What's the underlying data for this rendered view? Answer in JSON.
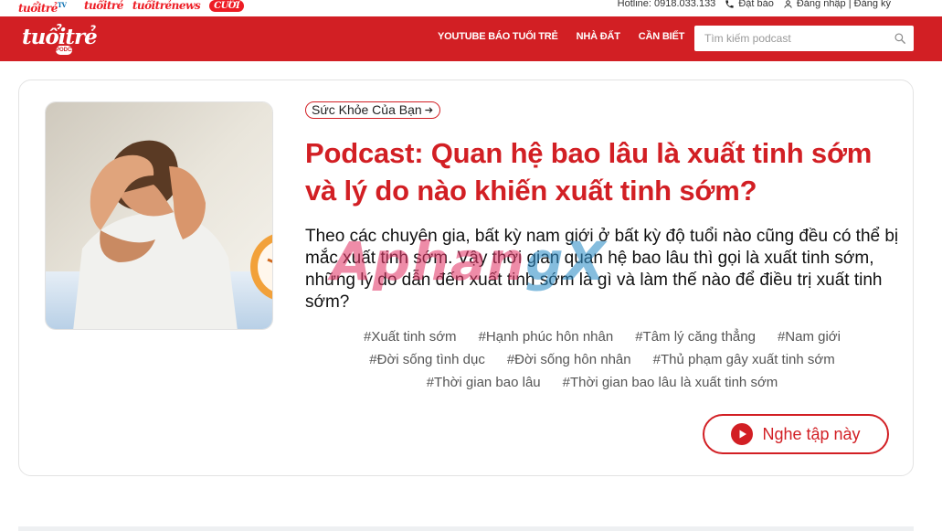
{
  "brands": [
    {
      "name": "tuoi-tre-tv-logo",
      "label": "tuổitrẻ",
      "suffix": "TV"
    },
    {
      "name": "tuoi-tre-cuoi-tuan-logo",
      "label": "tuổitrẻ"
    },
    {
      "name": "tuoi-tre-news-logo",
      "label": "tuổitrẻnews"
    },
    {
      "name": "tuoi-tre-cuoi-logo",
      "label": "CƯỜI"
    }
  ],
  "utility": {
    "hotline": "Hotline: 0918.033.133",
    "subscribe": "Đặt báo",
    "account": "Đăng nhập | Đăng ký"
  },
  "header": {
    "logo_text": "tuổitrẻ",
    "logo_badge": "PODCAST",
    "nav": [
      "YOUTUBE BÁO TUỔI TRẺ",
      "NHÀ ĐẤT",
      "CẦN BIẾT"
    ],
    "search_placeholder": "Tìm kiếm podcast"
  },
  "episode": {
    "category": "Sức Khỏe Của Bạn",
    "title": "Podcast: Quan hệ bao lâu là xuất tinh sớm và lý do nào khiến xuất tinh sớm?",
    "summary": "Theo các chuyên gia, bất kỳ nam giới ở bất kỳ độ tuổi nào cũng đều có thể bị mắc xuất tinh sớm. Vậy thời gian quan hệ bao lâu thì gọi là xuất tinh sớm, những lý do dẫn đến xuất tinh sớm là gì và làm thế nào để điều trị xuất tinh sớm?",
    "tags": [
      "#Xuất tinh sớm",
      "#Hạnh phúc hôn nhân",
      "#Tâm lý căng thẳng",
      "#Nam giới",
      "#Đời sống tình dục",
      "#Đời sống hôn nhân",
      "#Thủ phạm gây xuất tinh sớm",
      "#Thời gian bao lâu",
      "#Thời gian bao lâu là xuất tinh sớm"
    ],
    "listen_label": "Nghe tập này"
  },
  "watermark": {
    "part1": "Aphan",
    "part2": "gX"
  },
  "colors": {
    "brand_red": "#d21f24",
    "text": "#111111",
    "tag": "#555555"
  }
}
